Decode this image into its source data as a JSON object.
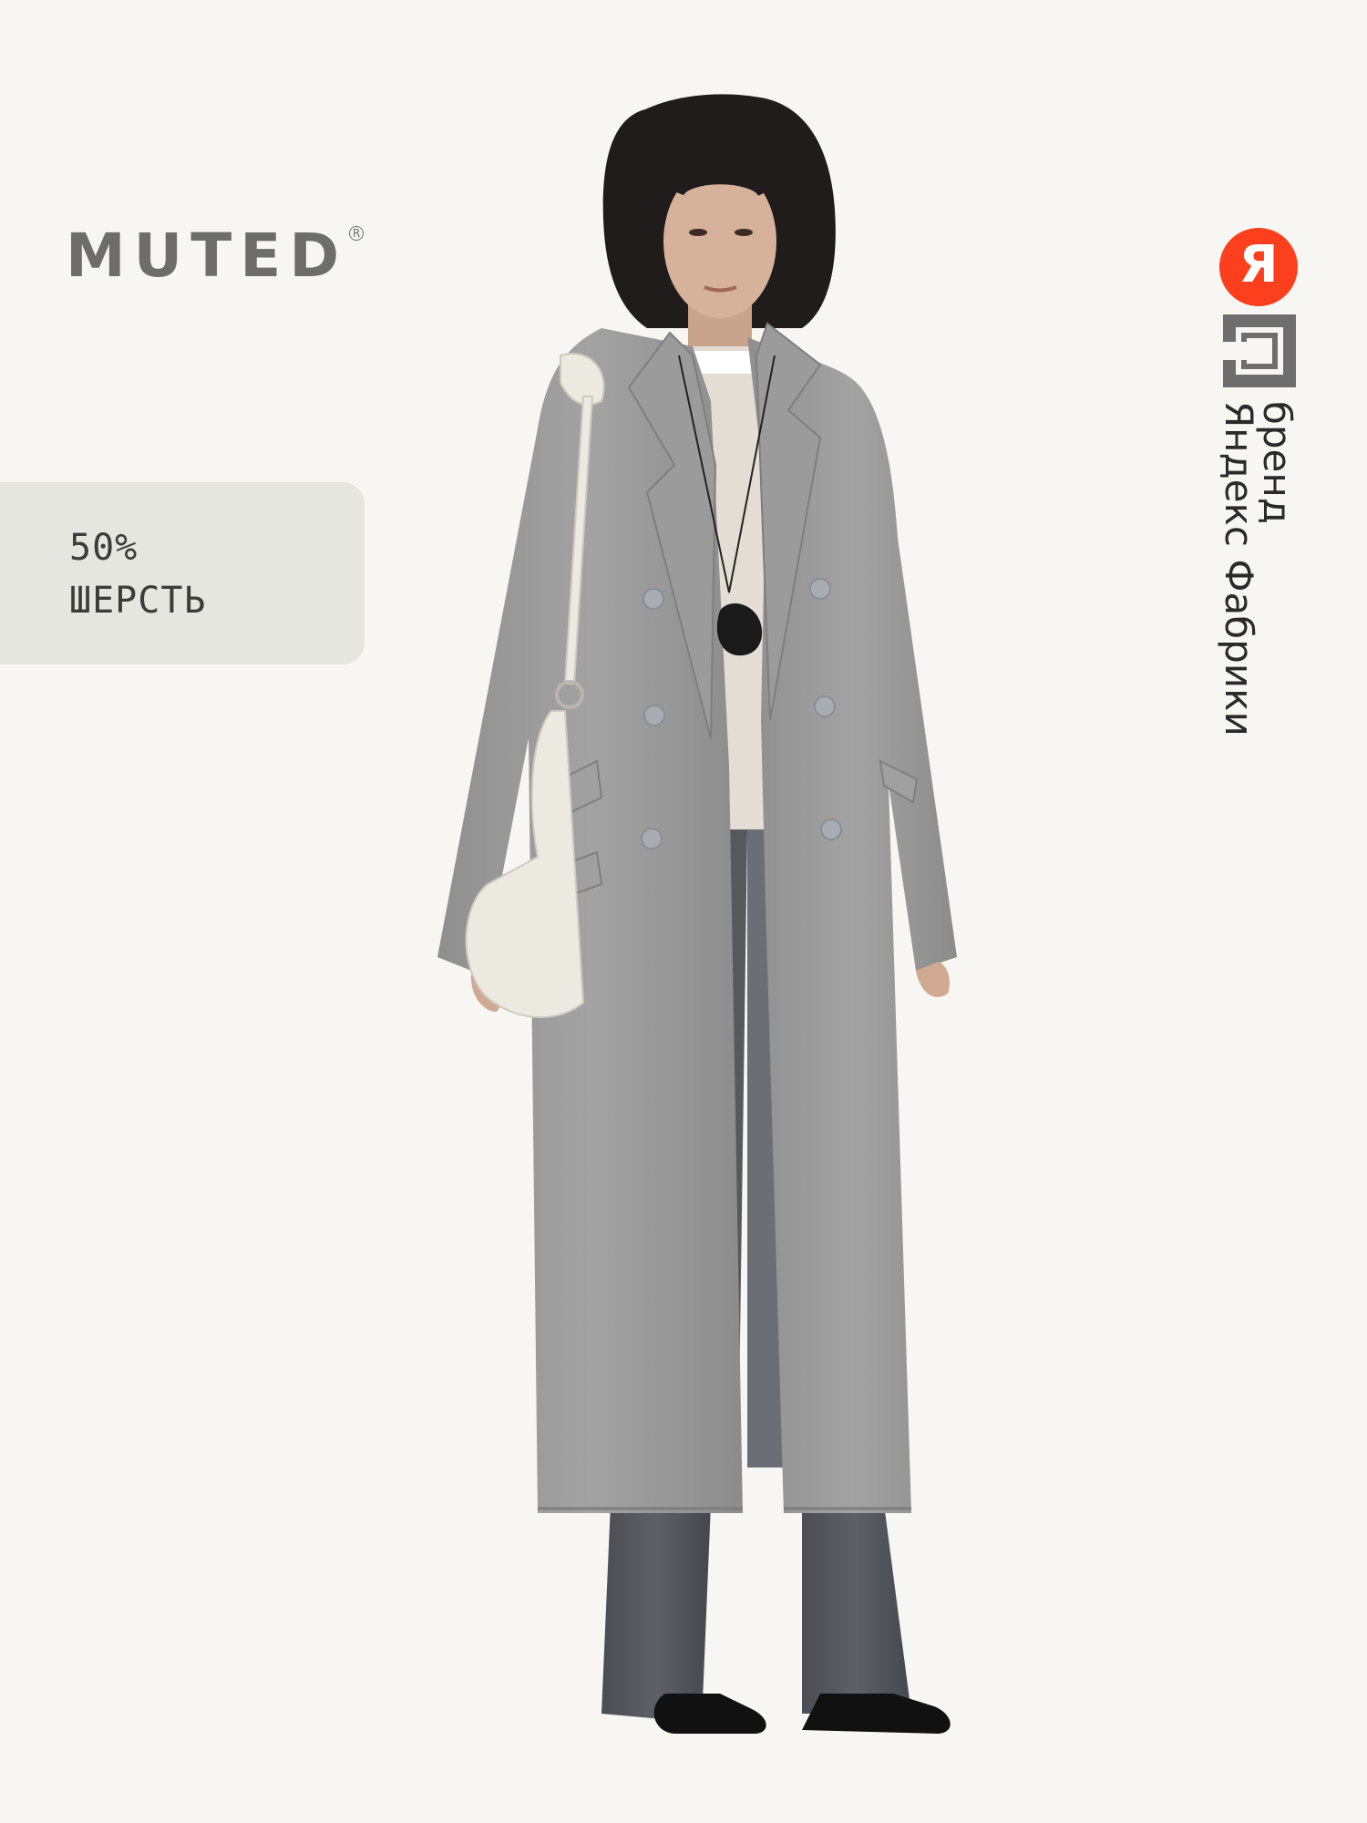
{
  "brand": {
    "name": "MUTED",
    "registered_mark": "R"
  },
  "badge": {
    "line1": "50%",
    "line2": "ШЕРСТЬ"
  },
  "yandex_mark": {
    "logo_letter": "Я",
    "line1": "бренд",
    "line2": "Яндекс Фабрики",
    "logo_color": "#fc3f1d",
    "icon": "factory-icon"
  },
  "colors": {
    "background": "#f7f6f2",
    "badge_bg": "#e6e6e1",
    "brand_text": "#6d6d6b",
    "coat": "#9a9a9a"
  }
}
